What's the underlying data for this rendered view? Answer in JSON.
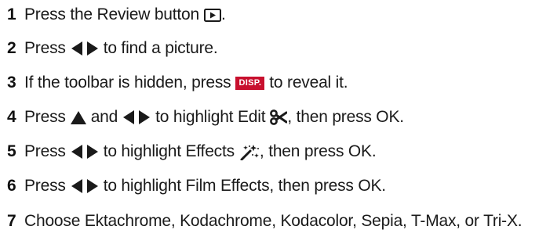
{
  "steps": [
    {
      "number": "1",
      "before": "Press the Review button",
      "after": "."
    },
    {
      "number": "2",
      "before": "Press",
      "after": "to find a picture."
    },
    {
      "number": "3",
      "before": "If the toolbar is hidden, press",
      "badge": "DISP.",
      "after": "to reveal it."
    },
    {
      "number": "4",
      "before": "Press",
      "middle": "and",
      "after": "to highlight Edit",
      "tail": ", then press OK."
    },
    {
      "number": "5",
      "before": "Press",
      "after": "to highlight Effects",
      "tail": ", then press OK."
    },
    {
      "number": "6",
      "before": "Press",
      "after": "to highlight Film Effects, then press OK."
    },
    {
      "number": "7",
      "before": "Choose Ektachrome, Kodachrome, Kodacolor, Sepia, T-Max, or Tri-X."
    }
  ],
  "icons": {
    "review": "review-button-icon",
    "left_right": "left-right-arrows-icon",
    "up": "up-arrow-icon",
    "edit": "scissors-icon",
    "effects": "magic-wand-sparkles-icon"
  },
  "colors": {
    "text": "#1a1a1a",
    "disp_badge": "#c8102e"
  }
}
